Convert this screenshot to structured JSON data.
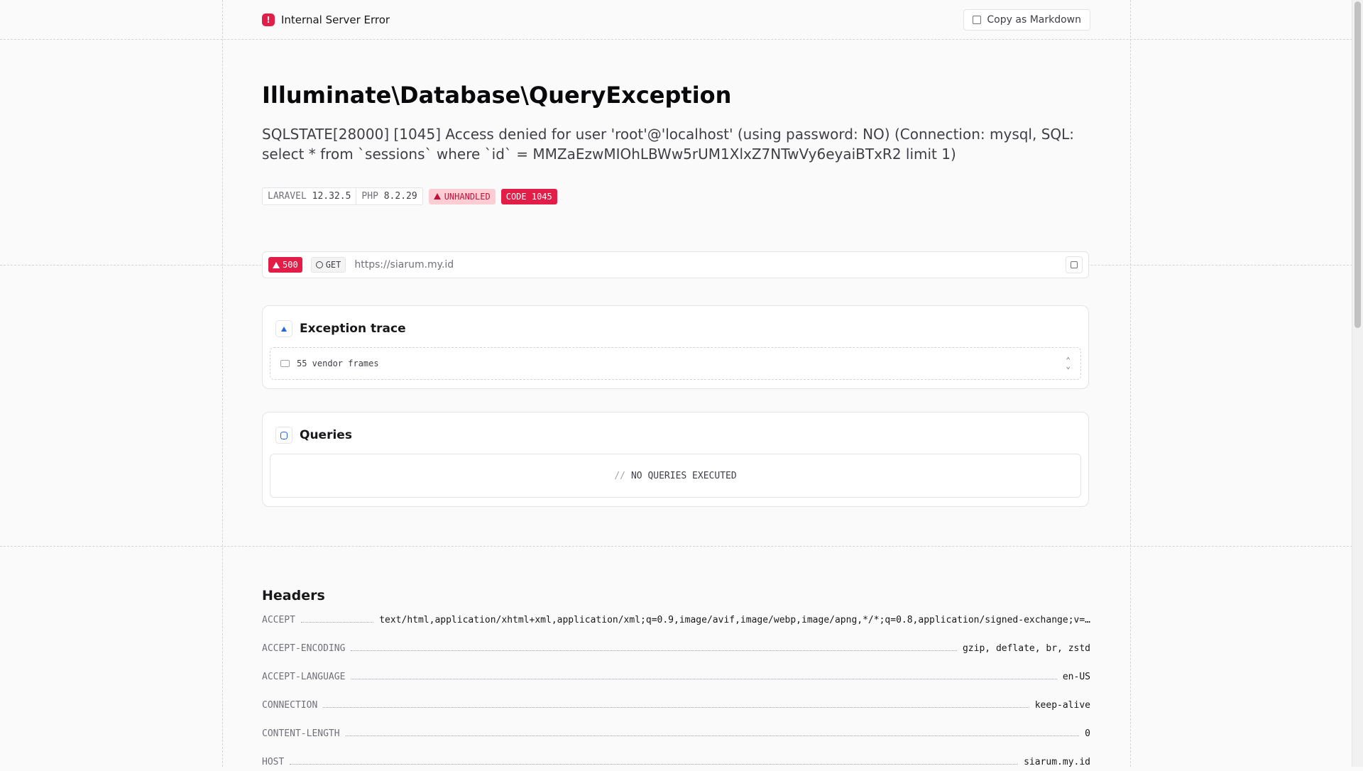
{
  "topbar": {
    "title": "Internal Server Error",
    "icon": "!",
    "copy_label": "Copy as Markdown"
  },
  "exception": {
    "class": "Illuminate\\Database\\QueryException",
    "message": "SQLSTATE[28000] [1045] Access denied for user 'root'@'localhost' (using password: NO) (Connection: mysql, SQL: select * from `sessions` where `id` = MMZaEzwMIOhLBWw5rUM1XlxZ7NTwVy6eyaiBTxR2 limit 1)"
  },
  "versions": {
    "laravel_label": "LARAVEL",
    "laravel": "12.32.5",
    "php_label": "PHP",
    "php": "8.2.29"
  },
  "badges": {
    "unhandled": "UNHANDLED",
    "code": "CODE 1045"
  },
  "request": {
    "status": "500",
    "method": "GET",
    "url": "https://siarum.my.id"
  },
  "trace": {
    "title": "Exception trace",
    "vendor_frames": "55 vendor frames"
  },
  "queries": {
    "title": "Queries",
    "empty_prefix": "//",
    "empty": "NO QUERIES EXECUTED"
  },
  "headers": {
    "title": "Headers",
    "rows": [
      {
        "key": "ACCEPT",
        "value": "text/html,application/xhtml+xml,application/xml;q=0.9,image/avif,image/webp,image/apng,*/*;q=0.8,application/signed-exchange;v=…"
      },
      {
        "key": "ACCEPT-ENCODING",
        "value": "gzip, deflate, br, zstd"
      },
      {
        "key": "ACCEPT-LANGUAGE",
        "value": "en-US"
      },
      {
        "key": "CONNECTION",
        "value": "keep-alive"
      },
      {
        "key": "CONTENT-LENGTH",
        "value": "0"
      },
      {
        "key": "HOST",
        "value": "siarum.my.id"
      }
    ]
  },
  "colors": {
    "accent": "#e11d48",
    "info": "#2563eb"
  }
}
